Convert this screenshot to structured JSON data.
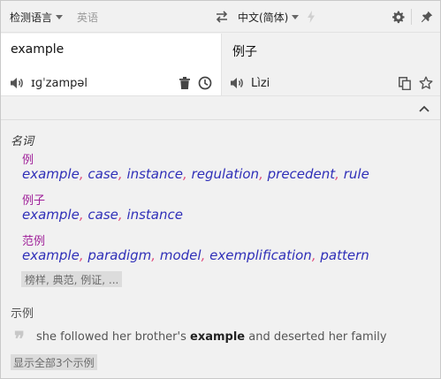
{
  "toolbar": {
    "source_language": "检测语言",
    "detected_language": "英语",
    "target_language": "中文(简体)"
  },
  "source": {
    "text": "example",
    "phonetic": "ɪɡˈzampəl"
  },
  "target": {
    "text": "例子",
    "phonetic": "Lìzi"
  },
  "dictionary": {
    "part_of_speech": "名词",
    "senses": [
      {
        "headword": "例",
        "synonyms": [
          "example",
          "case",
          "instance",
          "regulation",
          "precedent",
          "rule"
        ]
      },
      {
        "headword": "例子",
        "synonyms": [
          "example",
          "case",
          "instance"
        ]
      },
      {
        "headword": "范例",
        "synonyms": [
          "example",
          "paradigm",
          "model",
          "exemplification",
          "pattern"
        ]
      }
    ],
    "more_label": "榜样, 典范, 例证, ..."
  },
  "examples": {
    "heading": "示例",
    "sentence_before": "she followed her brother's ",
    "sentence_highlight": "example",
    "sentence_after": " and deserted her family",
    "show_all_label": "显示全部3个示例"
  },
  "colors": {
    "headword": "#a0229a",
    "synonym": "#2f2fb8",
    "separator": "#e14a7d"
  }
}
